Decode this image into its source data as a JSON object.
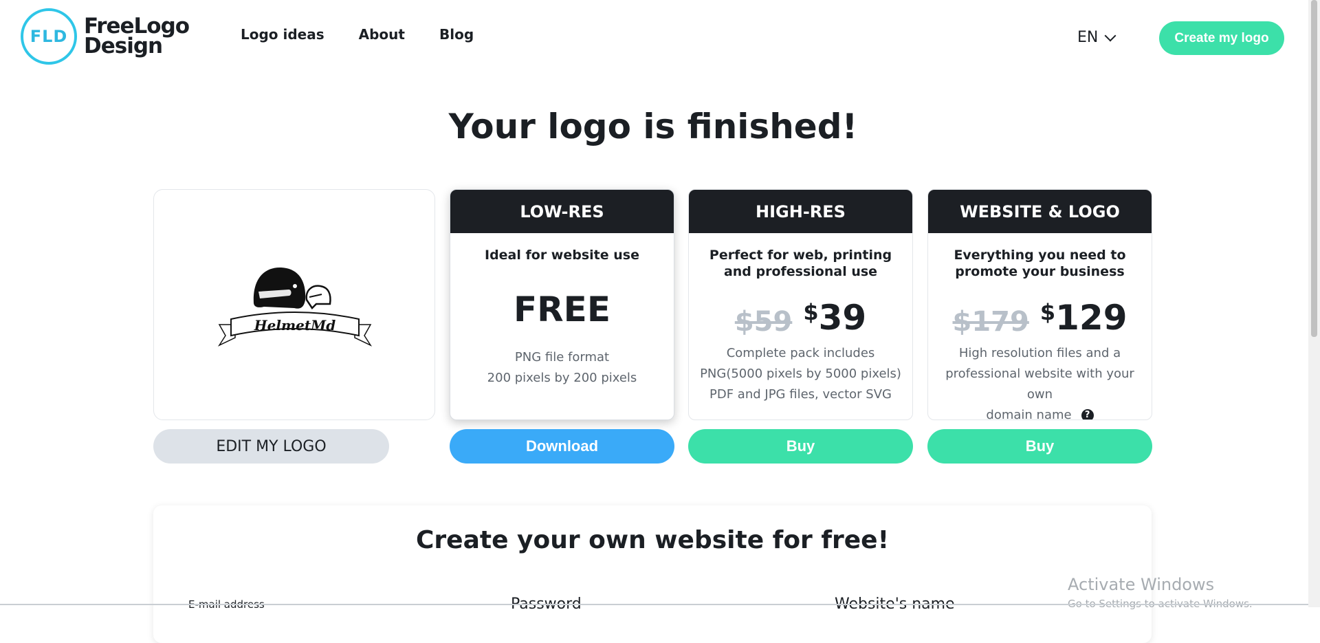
{
  "brand": {
    "mark": "FLD",
    "line1": "FreeLogo",
    "line2": "Design"
  },
  "nav": {
    "items": [
      "Logo ideas",
      "About",
      "Blog"
    ]
  },
  "language": "EN",
  "header_cta": "Create my logo",
  "page_title": "Your logo is finished!",
  "logo_preview": {
    "brand_text": "HelmetMd"
  },
  "edit_button": "EDIT MY LOGO",
  "plans": [
    {
      "name": "LOW-RES",
      "subtitle": "Ideal for website use",
      "price": "FREE",
      "details": [
        "PNG file format",
        "200 pixels by 200 pixels"
      ],
      "button": "Download",
      "button_color": "#3aaaf8"
    },
    {
      "name": "HIGH-RES",
      "subtitle": "Perfect for web, printing and professional use",
      "old_price": "$59",
      "currency": "$",
      "price": "39",
      "details": [
        "Complete pack includes",
        "PNG(5000 pixels by 5000 pixels)",
        "PDF and JPG files, vector SVG"
      ],
      "button": "Buy",
      "button_color": "#3ce0a9"
    },
    {
      "name": "WEBSITE & LOGO",
      "subtitle": "Everything you need to promote your business",
      "old_price": "$179",
      "currency": "$",
      "price": "129",
      "details": [
        "High resolution files and a",
        "professional website with your own",
        "domain name"
      ],
      "help": "?",
      "button": "Buy",
      "button_color": "#3ce0a9"
    }
  ],
  "website_section": {
    "title": "Create your own website for free!",
    "fields": [
      "E-mail address",
      "Password",
      "Website's name"
    ]
  },
  "watermark": {
    "line1": "Activate Windows",
    "line2": "Go to Settings to activate Windows."
  },
  "colors": {
    "accent_green": "#3ce0a9",
    "accent_blue": "#3aaaf8",
    "dark": "#1c1f24",
    "logo_ring": "#2fc6e8"
  }
}
